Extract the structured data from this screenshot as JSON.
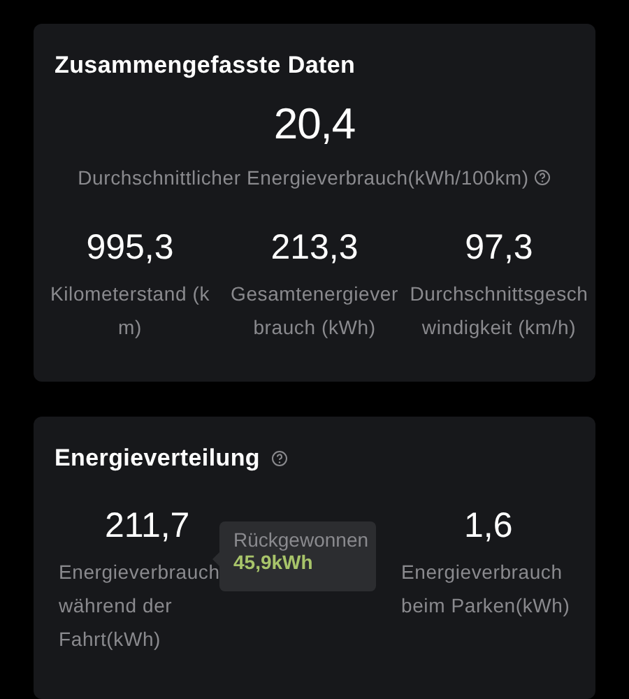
{
  "summary": {
    "title": "Zusammengefasste Daten",
    "main": {
      "value": "20,4",
      "label": "Durchschnittlicher Energieverbrauch(kWh/100km)"
    },
    "stats": [
      {
        "value": "995,3",
        "label": "Kilometerstand (km)"
      },
      {
        "value": "213,3",
        "label": "Gesamtenergieverbrauch (kWh)"
      },
      {
        "value": "97,3",
        "label": "Durchschnittsgeschwindigkeit (km/h)"
      }
    ]
  },
  "distribution": {
    "title": "Energieverteilung",
    "stats": [
      {
        "value": "211,7",
        "label": "Energieverbrauch während der Fahrt(kWh)"
      },
      {
        "value": "1,6",
        "label": "Energieverbrauch beim Parken(kWh)"
      }
    ],
    "tooltip": {
      "title": "Rückgewonnen",
      "value": "45,9kWh"
    }
  }
}
